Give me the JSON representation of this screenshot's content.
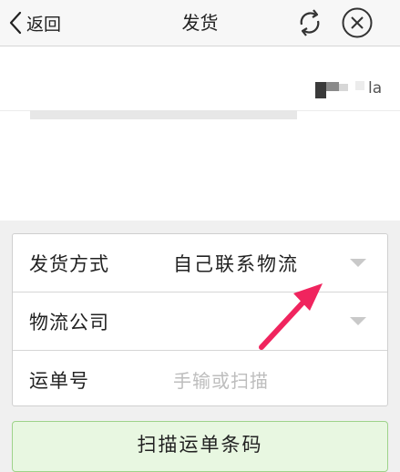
{
  "navbar": {
    "back_label": "返回",
    "title": "发货"
  },
  "info": {
    "partial_text": "la"
  },
  "form": {
    "shipping_method": {
      "label": "发货方式",
      "value": "自己联系物流"
    },
    "logistics_company": {
      "label": "物流公司",
      "value": ""
    },
    "tracking_number": {
      "label": "运单号",
      "placeholder": "手输或扫描"
    }
  },
  "scan_button": {
    "label": "扫描运单条码"
  },
  "colors": {
    "annotation_arrow": "#f0245e",
    "scan_button_bg": "#e8f7e1",
    "scan_button_border": "#9ed38a"
  }
}
